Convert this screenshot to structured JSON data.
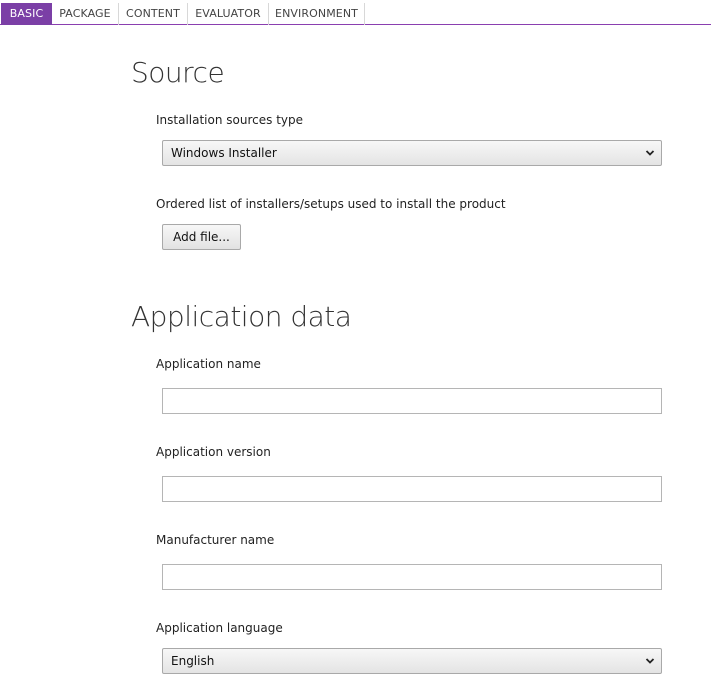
{
  "tabs": [
    {
      "label": "BASIC",
      "active": true
    },
    {
      "label": "PACKAGE",
      "active": false
    },
    {
      "label": "CONTENT",
      "active": false
    },
    {
      "label": "EVALUATOR",
      "active": false
    },
    {
      "label": "ENVIRONMENT",
      "active": false
    }
  ],
  "source": {
    "title": "Source",
    "sources_type_label": "Installation sources type",
    "sources_type_value": "Windows Installer",
    "installers_label": "Ordered list of installers/setups used to install the product",
    "add_file_label": "Add file..."
  },
  "app_data": {
    "title": "Application data",
    "name_label": "Application name",
    "name_value": "",
    "version_label": "Application version",
    "version_value": "",
    "manufacturer_label": "Manufacturer name",
    "manufacturer_value": "",
    "language_label": "Application language",
    "language_value": "English"
  },
  "colors": {
    "accent": "#7b3fa6"
  }
}
